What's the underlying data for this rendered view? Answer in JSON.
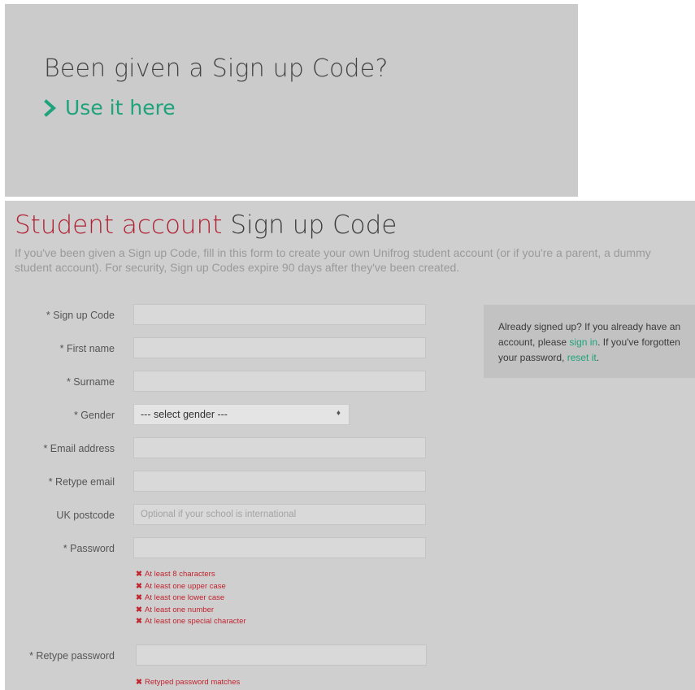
{
  "promo": {
    "title": "Been given a Sign up Code?",
    "link_label": "Use it here",
    "link_color": "#1fa37a"
  },
  "page": {
    "title_highlight": "Student account",
    "title_rest": "Sign up Code",
    "intro": "If you've been given a Sign up Code, fill in this form to create your own Unifrog student account (or if you're a parent, a dummy student account). For security, Sign up Codes expire 90 days after they've been created.",
    "accent_color": "#b02134"
  },
  "form": {
    "sign_up_code_label": "* Sign up Code",
    "first_name_label": "* First name",
    "surname_label": "* Surname",
    "gender_label": "* Gender",
    "gender_value": "--- select gender ---",
    "email_label": "* Email address",
    "retype_email_label": "* Retype email",
    "postcode_label": "UK postcode",
    "postcode_placeholder": "Optional if your school is international",
    "password_label": "* Password",
    "password_rules": [
      "At least 8 characters",
      "At least one upper case",
      "At least one lower case",
      "At least one number",
      "At least one special character"
    ],
    "retype_password_label": "* Retype password",
    "retype_rule": "Retyped password matches",
    "error_color": "#c0242f"
  },
  "sidebar": {
    "text_1": "Already signed up? If you already have an account, please ",
    "sign_in_link": "sign in",
    "text_2": ". If you've forgotten your password, ",
    "reset_link": "reset it",
    "text_3": "."
  }
}
